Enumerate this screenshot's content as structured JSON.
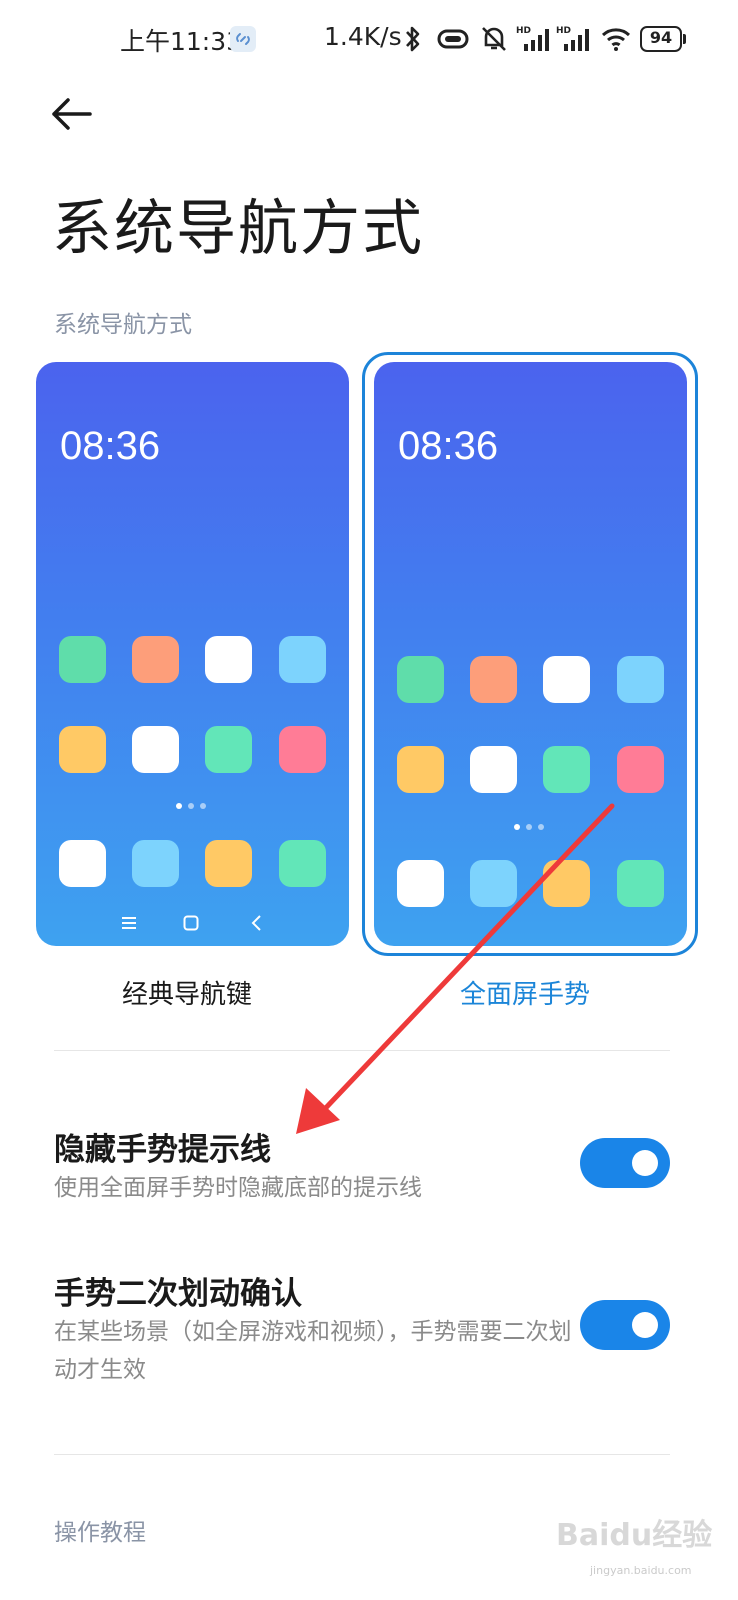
{
  "status_bar": {
    "time": "上午11:33",
    "speed": "1.4K/s",
    "battery": "94",
    "icons": [
      "link-icon",
      "bluetooth-icon",
      "vibrate-icon",
      "mute-icon",
      "signal-hd-1-icon",
      "signal-hd-2-icon",
      "wifi-icon",
      "battery-icon"
    ]
  },
  "header": {
    "back_icon": "arrow-left-icon",
    "title": "系统导航方式"
  },
  "nav_section": {
    "label": "系统导航方式",
    "options": [
      {
        "caption": "经典导航键",
        "clock": "08:36",
        "selected": false
      },
      {
        "caption": "全面屏手势",
        "clock": "08:36",
        "selected": true
      }
    ],
    "accent_color": "#1c84d9"
  },
  "settings": [
    {
      "title": "隐藏手势提示线",
      "description": "使用全面屏手势时隐藏底部的提示线",
      "enabled": true
    },
    {
      "title": "手势二次划动确认",
      "description": "在某些场景（如全屏游戏和视频），手势需要二次划动才生效",
      "enabled": true
    }
  ],
  "tutorial": {
    "label": "操作教程"
  },
  "watermark": {
    "brand": "Baidu经验",
    "url": "jingyan.baidu.com"
  },
  "colors": {
    "toggle_on": "#1a85e8",
    "annotation": "#ee3a3a"
  }
}
